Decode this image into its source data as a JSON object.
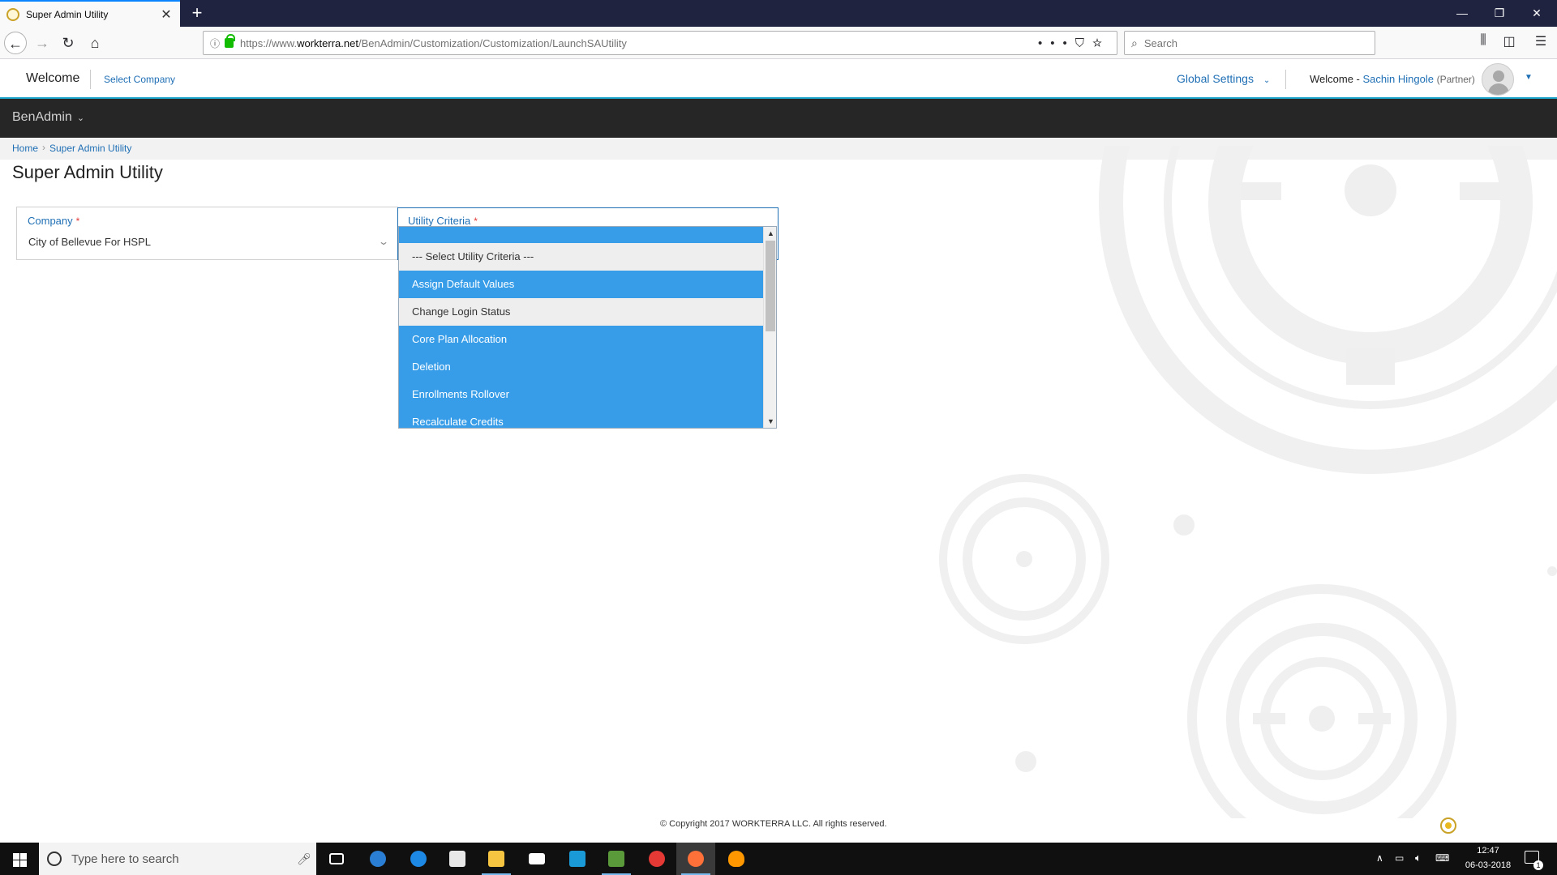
{
  "browser": {
    "tab_title": "Super Admin Utility",
    "tab_close": "✕",
    "new_tab": "+",
    "url_prefix": "https://www.",
    "url_domain": "workterra.net",
    "url_path": "/BenAdmin/Customization/Customization/LaunchSAUtility",
    "search_placeholder": "Search",
    "window_buttons": [
      "—",
      "❐",
      "✕"
    ]
  },
  "header": {
    "welcome": "Welcome",
    "select_company": "Select Company",
    "global_settings": "Global Settings",
    "welcome_prefix": "Welcome - ",
    "user_name": "Sachin Hingole",
    "user_role": "(Partner)"
  },
  "module": {
    "label": "BenAdmin"
  },
  "breadcrumb": {
    "home": "Home",
    "current": "Super Admin Utility"
  },
  "page": {
    "title": "Super Admin Utility"
  },
  "form": {
    "company_label": "Company",
    "company_value": "City of Bellevue For HSPL",
    "utility_label": "Utility Criteria",
    "required_mark": "*",
    "options": [
      "--- Select Utility Criteria ---",
      "Assign Default Values",
      "Change Login Status",
      "Core Plan Allocation",
      "Deletion",
      "Enrollments Rollover",
      "Recalculate Credits"
    ]
  },
  "footer": {
    "copyright": "© Copyright 2017 WORKTERRA LLC. All rights reserved."
  },
  "taskbar": {
    "search_placeholder": "Type here to search",
    "time": "12:47",
    "date": "06-03-2018",
    "notification_count": "1"
  },
  "colors": {
    "accent": "#379de8",
    "link": "#1f6fb5",
    "required": "#e23b3b",
    "module_bar": "#262626",
    "header_border": "#1aa3c8"
  },
  "icons": [
    "back-icon",
    "forward-icon",
    "reload-icon",
    "home-icon",
    "lock-icon",
    "search-icon",
    "bookmark-star-icon",
    "pocket-icon",
    "library-icon",
    "sidebar-icon",
    "menu-icon",
    "chevron-down-icon",
    "avatar-icon",
    "windows-start-icon",
    "microphone-icon"
  ]
}
